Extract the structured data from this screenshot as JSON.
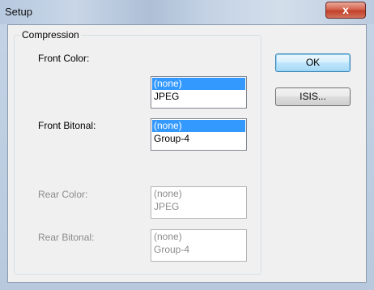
{
  "window": {
    "title": "Setup",
    "close_glyph": "x"
  },
  "group": {
    "label": "Compression"
  },
  "fields": {
    "front_color": {
      "label": "Front Color:",
      "options": [
        "(none)",
        "JPEG"
      ],
      "selected": "(none)",
      "enabled": true
    },
    "front_bitonal": {
      "label": "Front Bitonal:",
      "options": [
        "(none)",
        "Group-4"
      ],
      "selected": "(none)",
      "enabled": true
    },
    "rear_color": {
      "label": "Rear Color:",
      "options": [
        "(none)",
        "JPEG"
      ],
      "selected": null,
      "enabled": false
    },
    "rear_bitonal": {
      "label": "Rear Bitonal:",
      "options": [
        "(none)",
        "Group-4"
      ],
      "selected": null,
      "enabled": false
    }
  },
  "buttons": {
    "ok": "OK",
    "isis": "ISIS..."
  },
  "colors": {
    "selection": "#3399ff",
    "close_button": "#c2412b",
    "default_button_border": "#3c7fb1"
  }
}
